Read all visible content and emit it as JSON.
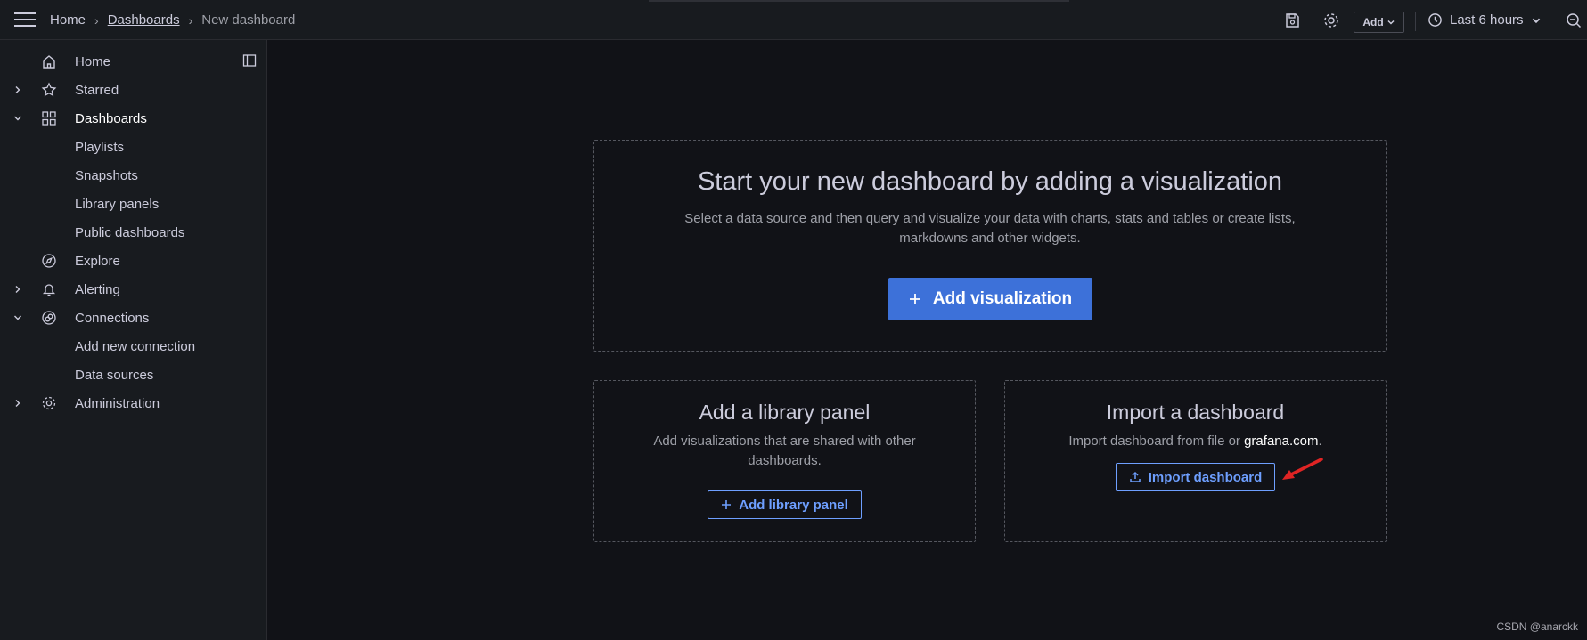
{
  "header": {
    "breadcrumb": [
      "Home",
      "Dashboards",
      "New dashboard"
    ],
    "add_label": "Add",
    "time_range": "Last 6 hours"
  },
  "sidebar": {
    "items": [
      {
        "label": "Home",
        "icon": "home-icon",
        "expander": "none"
      },
      {
        "label": "Starred",
        "icon": "star-icon",
        "expander": "collapsed"
      },
      {
        "label": "Dashboards",
        "icon": "apps-icon",
        "expander": "expanded"
      },
      {
        "label": "Playlists",
        "icon": "",
        "expander": "child"
      },
      {
        "label": "Snapshots",
        "icon": "",
        "expander": "child"
      },
      {
        "label": "Library panels",
        "icon": "",
        "expander": "child"
      },
      {
        "label": "Public dashboards",
        "icon": "",
        "expander": "child"
      },
      {
        "label": "Explore",
        "icon": "compass-icon",
        "expander": "none"
      },
      {
        "label": "Alerting",
        "icon": "bell-icon",
        "expander": "collapsed"
      },
      {
        "label": "Connections",
        "icon": "connections-icon",
        "expander": "expanded"
      },
      {
        "label": "Add new connection",
        "icon": "",
        "expander": "child"
      },
      {
        "label": "Data sources",
        "icon": "",
        "expander": "child"
      },
      {
        "label": "Administration",
        "icon": "cog-icon",
        "expander": "collapsed"
      }
    ]
  },
  "main": {
    "visualization": {
      "title": "Start your new dashboard by adding a visualization",
      "description": "Select a data source and then query and visualize your data with charts, stats and tables or create lists, markdowns and other widgets.",
      "button": "Add visualization"
    },
    "library": {
      "title": "Add a library panel",
      "description": "Add visualizations that are shared with other dashboards.",
      "button": "Add library panel"
    },
    "import": {
      "title": "Import a dashboard",
      "description_prefix": "Import dashboard from file or ",
      "description_link": "grafana.com",
      "description_suffix": ".",
      "button": "Import dashboard"
    }
  },
  "watermark": "CSDN @anarckk",
  "colors": {
    "background": "#111217",
    "panel": "#181b1f",
    "primary": "#3d71d9",
    "link": "#6e9fff",
    "annotation_arrow": "#e02424"
  }
}
